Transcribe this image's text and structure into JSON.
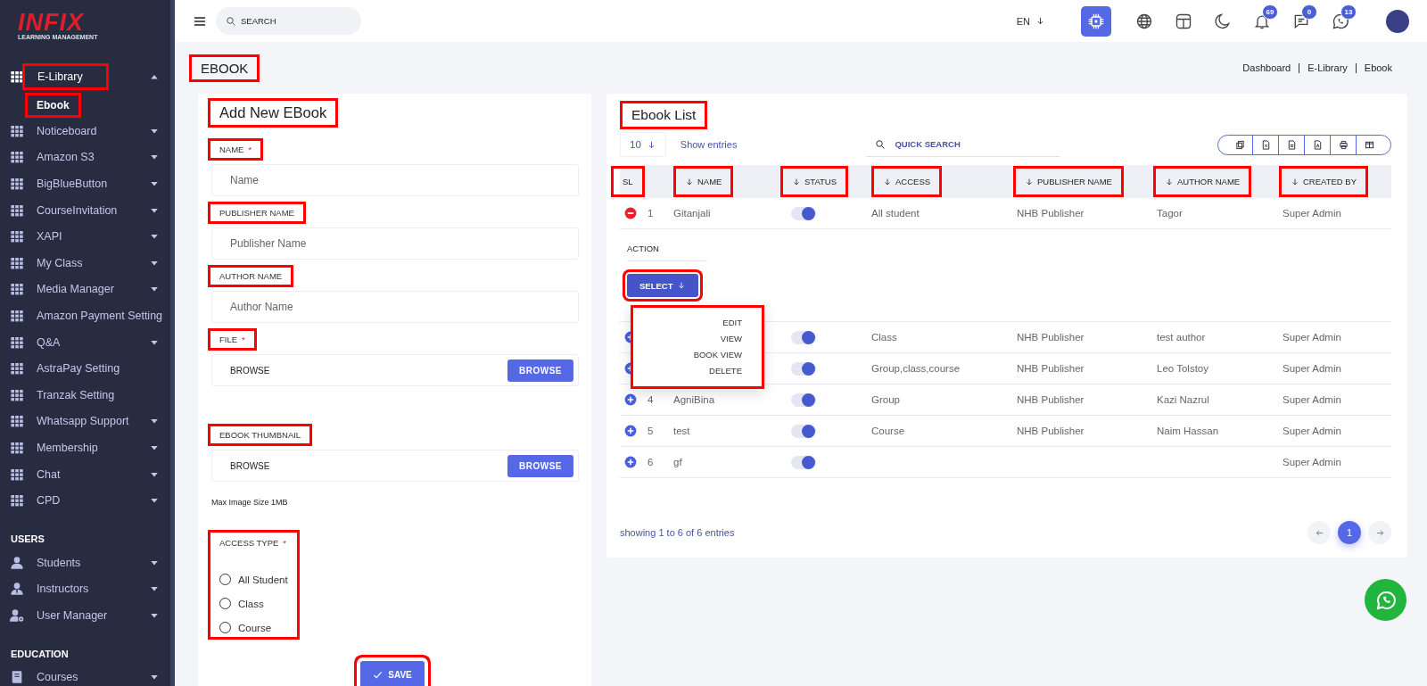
{
  "sidebar": {
    "logo": {
      "brand": "INFIX",
      "tagline": "LEARNING MANAGEMENT"
    },
    "groups": [
      {
        "items": [
          {
            "kind": "grid",
            "label": "E-Library",
            "expanded": true,
            "selected": true,
            "highlighted": true,
            "children": [
              {
                "label": "Ebook",
                "selected": true,
                "highlighted": true
              }
            ]
          },
          {
            "kind": "grid",
            "label": "Noticeboard",
            "expanded": false,
            "selected": false,
            "highlighted": false
          },
          {
            "kind": "grid",
            "label": "Amazon S3",
            "expanded": false,
            "selected": false,
            "highlighted": false
          },
          {
            "kind": "grid",
            "label": "BigBlueButton",
            "expanded": false,
            "selected": false,
            "highlighted": false
          },
          {
            "kind": "grid",
            "label": "CourseInvitation",
            "expanded": false,
            "selected": false,
            "highlighted": false
          },
          {
            "kind": "grid",
            "label": "XAPI",
            "expanded": false,
            "selected": false,
            "highlighted": false
          },
          {
            "kind": "grid",
            "label": "My Class",
            "expanded": false,
            "selected": false,
            "highlighted": false
          },
          {
            "kind": "grid",
            "label": "Media Manager",
            "expanded": false,
            "selected": false,
            "highlighted": false
          },
          {
            "kind": "grid",
            "label": "Amazon Payment Setting",
            "selected": false,
            "highlighted": false
          },
          {
            "kind": "grid",
            "label": "Q&A",
            "expanded": false,
            "selected": false,
            "highlighted": false
          },
          {
            "kind": "grid",
            "label": "AstraPay Setting",
            "selected": false,
            "highlighted": false
          },
          {
            "kind": "grid",
            "label": "Tranzak Setting",
            "selected": false,
            "highlighted": false
          },
          {
            "kind": "grid",
            "label": "Whatsapp Support",
            "expanded": false,
            "selected": false,
            "highlighted": false
          },
          {
            "kind": "grid",
            "label": "Membership",
            "expanded": false,
            "selected": false,
            "highlighted": false
          },
          {
            "kind": "grid",
            "label": "Chat",
            "expanded": false,
            "selected": false,
            "highlighted": false
          },
          {
            "kind": "grid",
            "label": "CPD",
            "expanded": false,
            "selected": false,
            "highlighted": false
          }
        ]
      },
      {
        "heading": "USERS",
        "items": [
          {
            "kind": "user",
            "label": "Students",
            "expanded": false,
            "selected": false,
            "highlighted": false
          },
          {
            "kind": "user-tie",
            "label": "Instructors",
            "expanded": false,
            "selected": false,
            "highlighted": false
          },
          {
            "kind": "user-gear",
            "label": "User Manager",
            "expanded": false,
            "selected": false,
            "highlighted": false
          }
        ]
      },
      {
        "heading": "EDUCATION",
        "items": [
          {
            "kind": "book",
            "label": "Courses",
            "expanded": false,
            "selected": false,
            "highlighted": false
          }
        ]
      }
    ]
  },
  "topbar": {
    "search": {
      "placeholder": "SEARCH"
    },
    "language": "EN",
    "ai_button": {
      "active": true
    },
    "notifications": [
      {
        "kind": "bell",
        "badge": "69"
      },
      {
        "kind": "chat",
        "badge": "0"
      },
      {
        "kind": "phone-chat",
        "badge": "13"
      }
    ]
  },
  "page": {
    "title": "EBOOK",
    "highlighted": true,
    "breadcrumb": [
      "Dashboard",
      "E-Library",
      "Ebook"
    ]
  },
  "form": {
    "title": "Add New EBook",
    "highlighted": true,
    "fields": [
      {
        "kind": "text",
        "label": "NAME",
        "required_mark": "*",
        "placeholder": "Name",
        "highlighted": true
      },
      {
        "kind": "text",
        "label": "PUBLISHER NAME",
        "placeholder": "Publisher Name",
        "highlighted": true
      },
      {
        "kind": "text",
        "label": "AUTHOR NAME",
        "placeholder": "Author Name",
        "highlighted": true
      },
      {
        "kind": "file",
        "label": "FILE",
        "required_mark": "*",
        "value": "BROWSE",
        "button": "BROWSE",
        "highlighted": true
      },
      {
        "kind": "file",
        "label": "EBOOK THUMBNAIL",
        "value": "BROWSE",
        "button": "BROWSE",
        "note": "Max Image Size 1MB",
        "highlighted": true
      },
      {
        "kind": "radio",
        "label": "ACCESS TYPE",
        "required_mark": "*",
        "highlighted": true,
        "options": [
          {
            "label": "All Student",
            "selected": false
          },
          {
            "label": "Class",
            "selected": false
          },
          {
            "label": "Course",
            "selected": false
          }
        ]
      }
    ],
    "save": {
      "label": "SAVE",
      "highlighted": true
    }
  },
  "list": {
    "title": "Ebook List",
    "highlighted": true,
    "page_length": "10",
    "show_entries": "Show entries",
    "search": {
      "placeholder": "QUICK SEARCH"
    },
    "columns": [
      {
        "label": "SL",
        "sortable": false,
        "highlighted": true
      },
      {
        "label": "NAME",
        "sortable": true,
        "highlighted": true
      },
      {
        "label": "STATUS",
        "sortable": true,
        "highlighted": true
      },
      {
        "label": "ACCESS",
        "sortable": true,
        "highlighted": true
      },
      {
        "label": "PUBLISHER NAME",
        "sortable": true,
        "highlighted": true
      },
      {
        "label": "AUTHOR NAME",
        "sortable": true,
        "highlighted": true
      },
      {
        "label": "CREATED BY",
        "sortable": true,
        "highlighted": true
      }
    ],
    "rows": [
      {
        "sl": "1",
        "name": "Gitanjali",
        "status_on": true,
        "access": "All student",
        "publisher": "NHB Publisher",
        "author": "Tagor",
        "created_by": "Super Admin",
        "expanded": true,
        "action": {
          "label": "ACTION",
          "button": "SELECT",
          "highlighted": true,
          "menu": {
            "open": true,
            "highlighted": true,
            "items": [
              "EDIT",
              "VIEW",
              "BOOK VIEW",
              "DELETE"
            ]
          }
        }
      },
      {
        "status_on": true,
        "access": "Class",
        "publisher": "NHB Publisher",
        "author": "test author",
        "created_by": "Super Admin",
        "expanded": false
      },
      {
        "status_on": true,
        "access": "Group,class,course",
        "publisher": "NHB Publisher",
        "author": "Leo Tolstoy",
        "created_by": "Super Admin",
        "expanded": false
      },
      {
        "sl": "4",
        "name": "AgniBina",
        "status_on": true,
        "access": "Group",
        "publisher": "NHB Publisher",
        "author": "Kazi Nazrul",
        "created_by": "Super Admin",
        "expanded": false
      },
      {
        "sl": "5",
        "name": "test",
        "status_on": true,
        "access": "Course",
        "publisher": "NHB Publisher",
        "author": "Naim Hassan",
        "created_by": "Super Admin",
        "expanded": false
      },
      {
        "sl": "6",
        "name": "gf",
        "status_on": true,
        "access": "",
        "publisher": "",
        "author": "",
        "created_by": "Super Admin",
        "expanded": false
      }
    ],
    "info": "showing 1 to 6 of 6 entries",
    "pages": [
      {
        "label": "1",
        "selected": true
      }
    ]
  }
}
